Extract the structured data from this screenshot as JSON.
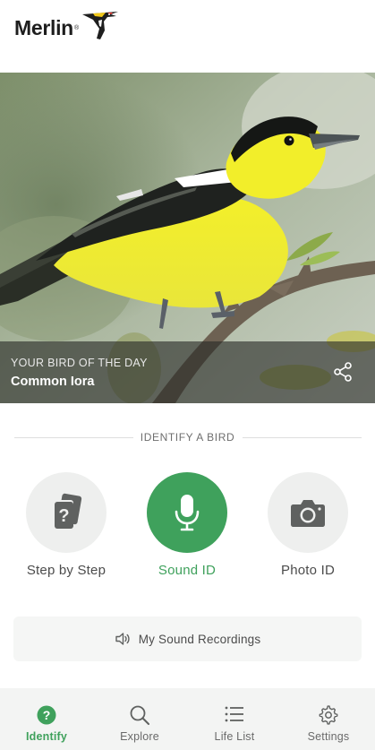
{
  "app": {
    "name": "Merlin",
    "trademark": "®"
  },
  "colors": {
    "brand_green": "#3fa15c",
    "inactive_icon": "#5f6160",
    "circle_bg": "#eeefee"
  },
  "bird_of_day": {
    "kicker": "YOUR BIRD OF THE DAY",
    "name": "Common Iora",
    "share_icon": "share-icon"
  },
  "identify": {
    "section_title": "IDENTIFY A BIRD",
    "tools": [
      {
        "label": "Step by Step",
        "icon": "question-cards-icon",
        "active": false
      },
      {
        "label": "Sound ID",
        "icon": "microphone-icon",
        "active": true
      },
      {
        "label": "Photo ID",
        "icon": "camera-icon",
        "active": false
      }
    ],
    "recordings_label": "My Sound Recordings",
    "recordings_icon": "speaker-icon"
  },
  "nav": {
    "items": [
      {
        "label": "Identify",
        "icon": "question-circle-icon",
        "active": true
      },
      {
        "label": "Explore",
        "icon": "search-icon",
        "active": false
      },
      {
        "label": "Life List",
        "icon": "list-icon",
        "active": false
      },
      {
        "label": "Settings",
        "icon": "gear-icon",
        "active": false
      }
    ]
  }
}
